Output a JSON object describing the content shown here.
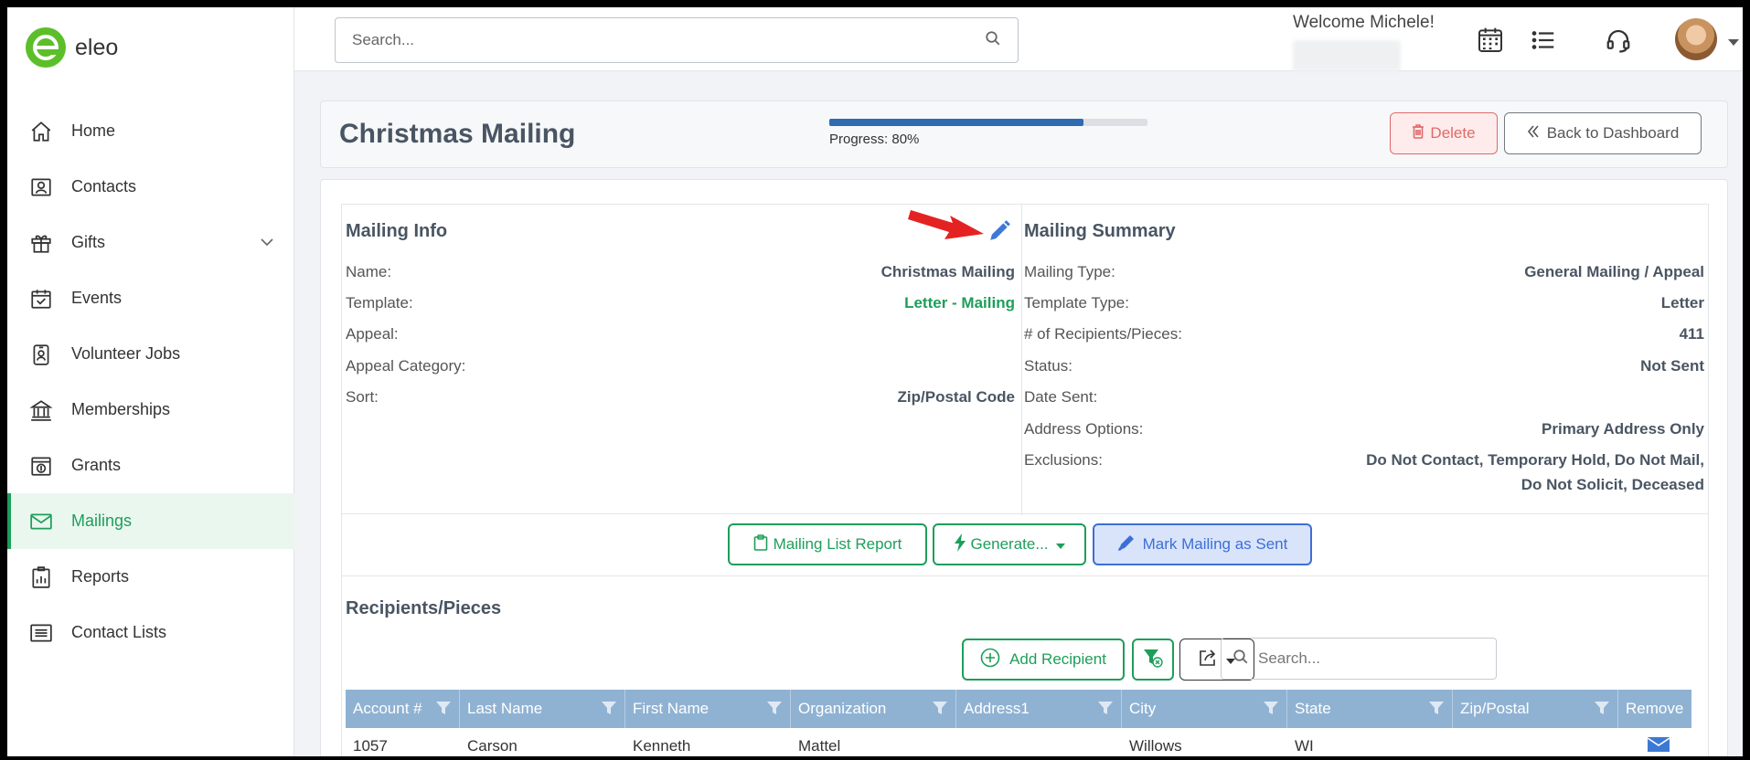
{
  "app": {
    "name": "eleo"
  },
  "sidebar": {
    "items": [
      {
        "label": "Home",
        "icon": "home-icon"
      },
      {
        "label": "Contacts",
        "icon": "contacts-icon"
      },
      {
        "label": "Gifts",
        "icon": "gift-icon"
      },
      {
        "label": "Events",
        "icon": "calendar-check-icon"
      },
      {
        "label": "Volunteer Jobs",
        "icon": "badge-icon"
      },
      {
        "label": "Memberships",
        "icon": "bank-icon"
      },
      {
        "label": "Grants",
        "icon": "money-icon"
      },
      {
        "label": "Mailings",
        "icon": "envelope-icon"
      },
      {
        "label": "Reports",
        "icon": "report-icon"
      },
      {
        "label": "Contact Lists",
        "icon": "list-icon"
      }
    ],
    "active": "Mailings"
  },
  "topbar": {
    "search_placeholder": "Search...",
    "welcome": "Welcome Michele!",
    "icons": [
      "calendar-grid-icon",
      "list-icon",
      "headset-icon",
      "avatar",
      "caret-down-icon"
    ]
  },
  "header": {
    "title": "Christmas Mailing",
    "progress_label": "Progress: 80%",
    "progress_value": 0.8,
    "delete_label": "Delete",
    "back_label": "Back to Dashboard"
  },
  "mailing_info": {
    "title": "Mailing Info",
    "rows": [
      {
        "label": "Name:",
        "value": "Christmas Mailing"
      },
      {
        "label": "Template:",
        "value": "Letter - Mailing"
      },
      {
        "label": "Appeal:",
        "value": ""
      },
      {
        "label": "Appeal Category:",
        "value": ""
      },
      {
        "label": "Sort:",
        "value": "Zip/Postal Code"
      }
    ]
  },
  "mailing_summary": {
    "title": "Mailing Summary",
    "rows": [
      {
        "label": "Mailing Type:",
        "value": "General Mailing / Appeal"
      },
      {
        "label": "Template Type:",
        "value": "Letter"
      },
      {
        "label": "# of Recipients/Pieces:",
        "value": "411"
      },
      {
        "label": "Status:",
        "value": "Not Sent"
      },
      {
        "label": "Date Sent:",
        "value": ""
      },
      {
        "label": "Address Options:",
        "value": "Primary Address Only"
      },
      {
        "label": "Exclusions:",
        "value": "Do Not Contact, Temporary Hold, Do Not Mail,",
        "value2": "Do Not Solicit, Deceased"
      }
    ]
  },
  "actions": {
    "mailing_list_report": "Mailing List Report",
    "generate": "Generate...",
    "mark_sent": "Mark Mailing as Sent"
  },
  "recipients": {
    "title": "Recipients/Pieces",
    "add_label": "Add Recipient",
    "search_placeholder": "Search...",
    "columns": [
      "Account #",
      "Last Name",
      "First Name",
      "Organization",
      "Address1",
      "City",
      "State",
      "Zip/Postal",
      "Remove"
    ],
    "rows": [
      {
        "account": "1057",
        "last": "Carson",
        "first": "Kenneth",
        "org": "Mattel",
        "address1": "",
        "city": "Willows",
        "state": "WI",
        "zip": ""
      }
    ]
  },
  "colors": {
    "accent_green": "#1e9e5a",
    "header_blue": "#8fb2d3",
    "danger": "#e06a6a",
    "action_blue": "#3d6fd4"
  }
}
